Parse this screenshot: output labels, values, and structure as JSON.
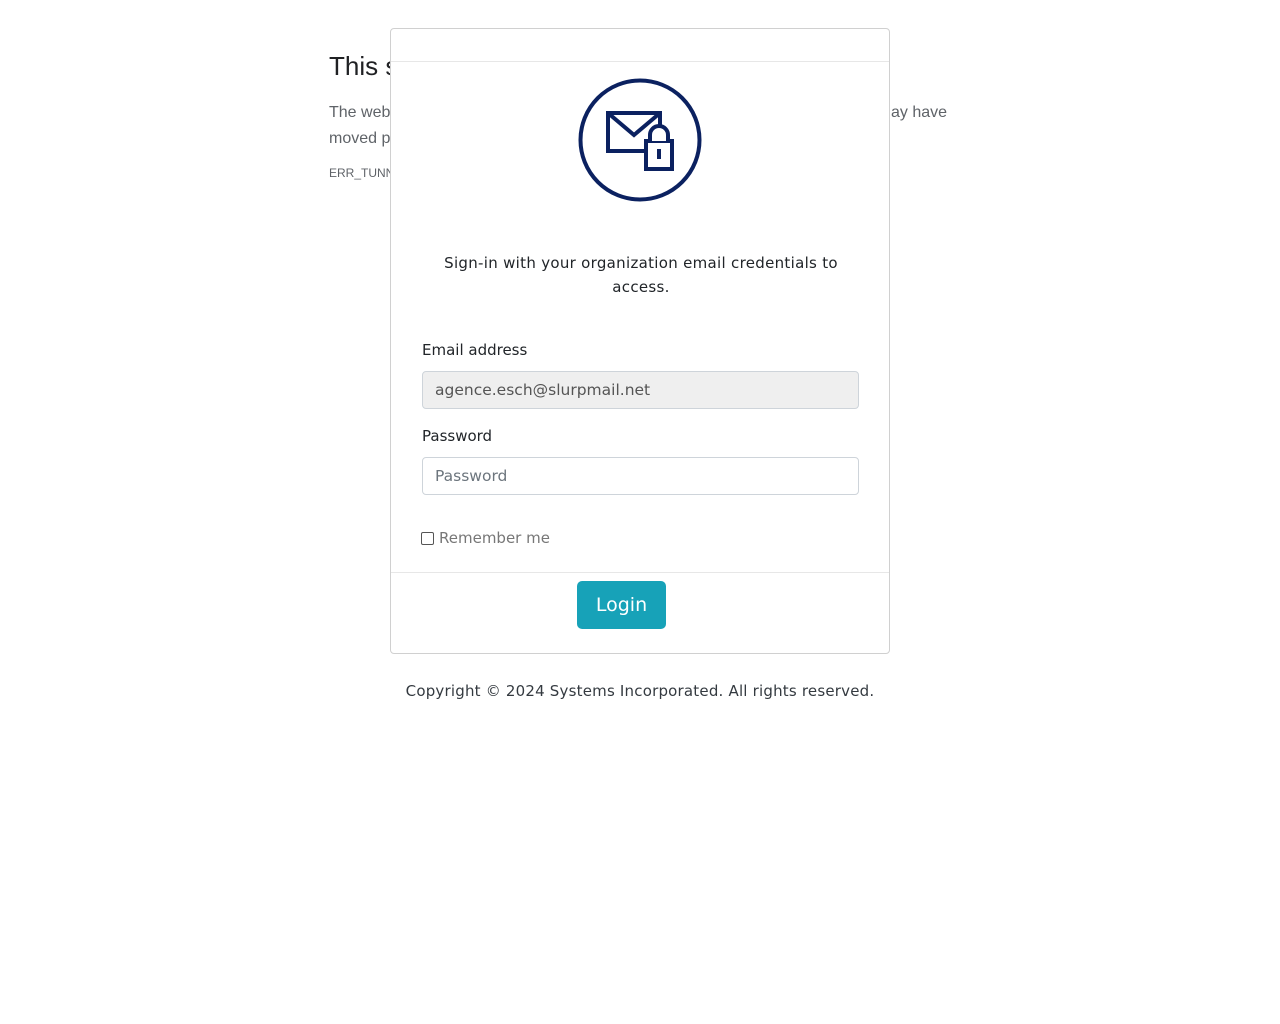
{
  "background_page": {
    "title_fragment": "This s",
    "description_left": "The web\nmoved p",
    "description_right": "ay have",
    "error_code_fragment": "ERR_TUNN"
  },
  "login_card": {
    "logo_icon": "mail-lock-icon",
    "accent_color": "#0b2160",
    "subtitle": "Sign-in with your organization email credentials to access.",
    "email_label": "Email address",
    "email_value": "agence.esch@slurpmail.net",
    "password_label": "Password",
    "password_placeholder": "Password",
    "remember_label": "Remember me",
    "login_button": "Login",
    "button_color": "#17a2b8"
  },
  "footer": {
    "copyright": "Copyright © 2024 Systems Incorporated. All rights reserved."
  }
}
